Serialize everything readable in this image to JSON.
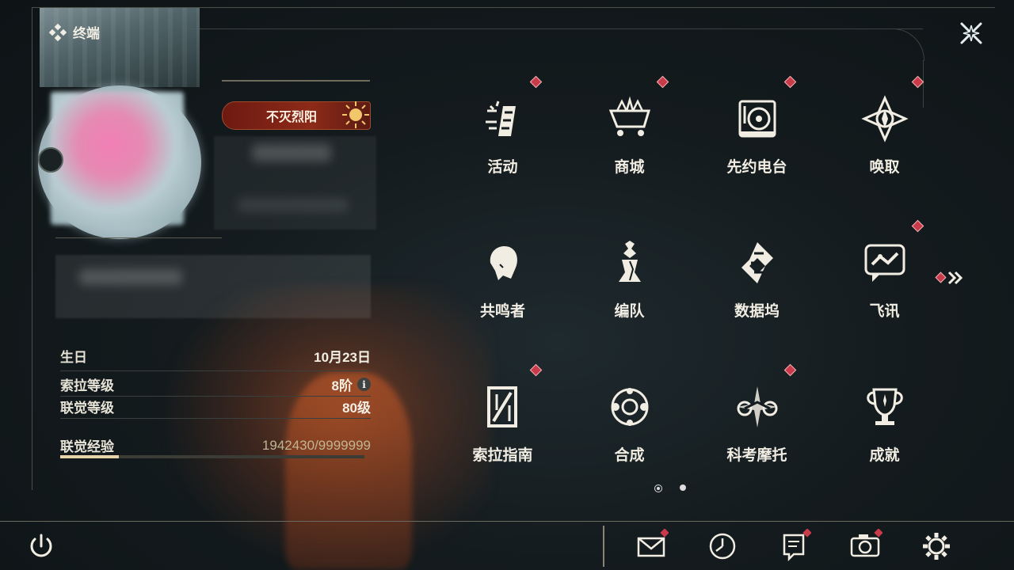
{
  "header": {
    "title": "终端"
  },
  "profile": {
    "title_badge": "不灭烈阳",
    "birthday_label": "生日",
    "birthday_value": "10月23日",
    "sola_level_label": "索拉等级",
    "sola_level_value": "8阶",
    "union_level_label": "联觉等级",
    "union_level_value": "80级",
    "union_exp_label": "联觉经验",
    "union_exp_value": "1942430/9999999",
    "union_exp_progress": 0.194
  },
  "grid": {
    "tiles": [
      {
        "label": "活动",
        "icon": "activity-icon",
        "badge": true
      },
      {
        "label": "商城",
        "icon": "shop-icon",
        "badge": true
      },
      {
        "label": "先约电台",
        "icon": "radio-icon",
        "badge": true
      },
      {
        "label": "唤取",
        "icon": "convene-icon",
        "badge": true
      },
      {
        "label": "共鸣者",
        "icon": "resonator-icon",
        "badge": false
      },
      {
        "label": "编队",
        "icon": "team-icon",
        "badge": false
      },
      {
        "label": "数据坞",
        "icon": "data-bank-icon",
        "badge": false
      },
      {
        "label": "飞讯",
        "icon": "message-icon",
        "badge": true
      },
      {
        "label": "索拉指南",
        "icon": "guidebook-icon",
        "badge": true
      },
      {
        "label": "合成",
        "icon": "synthesis-icon",
        "badge": false
      },
      {
        "label": "科考摩托",
        "icon": "motorcycle-icon",
        "badge": true
      },
      {
        "label": "成就",
        "icon": "achievement-icon",
        "badge": false
      }
    ],
    "page": {
      "current": 1,
      "total": 2
    }
  },
  "bottom_bar": [
    {
      "icon": "power-icon"
    },
    {
      "icon": "mail-icon",
      "badge": true
    },
    {
      "icon": "clock-icon",
      "badge": false
    },
    {
      "icon": "notice-icon",
      "badge": true
    },
    {
      "icon": "camera-icon",
      "badge": true
    },
    {
      "icon": "settings-icon",
      "badge": false
    }
  ],
  "colors": {
    "accent_red": "#c93a4a",
    "gold": "#e7d4a8",
    "background": "#141b1e"
  }
}
